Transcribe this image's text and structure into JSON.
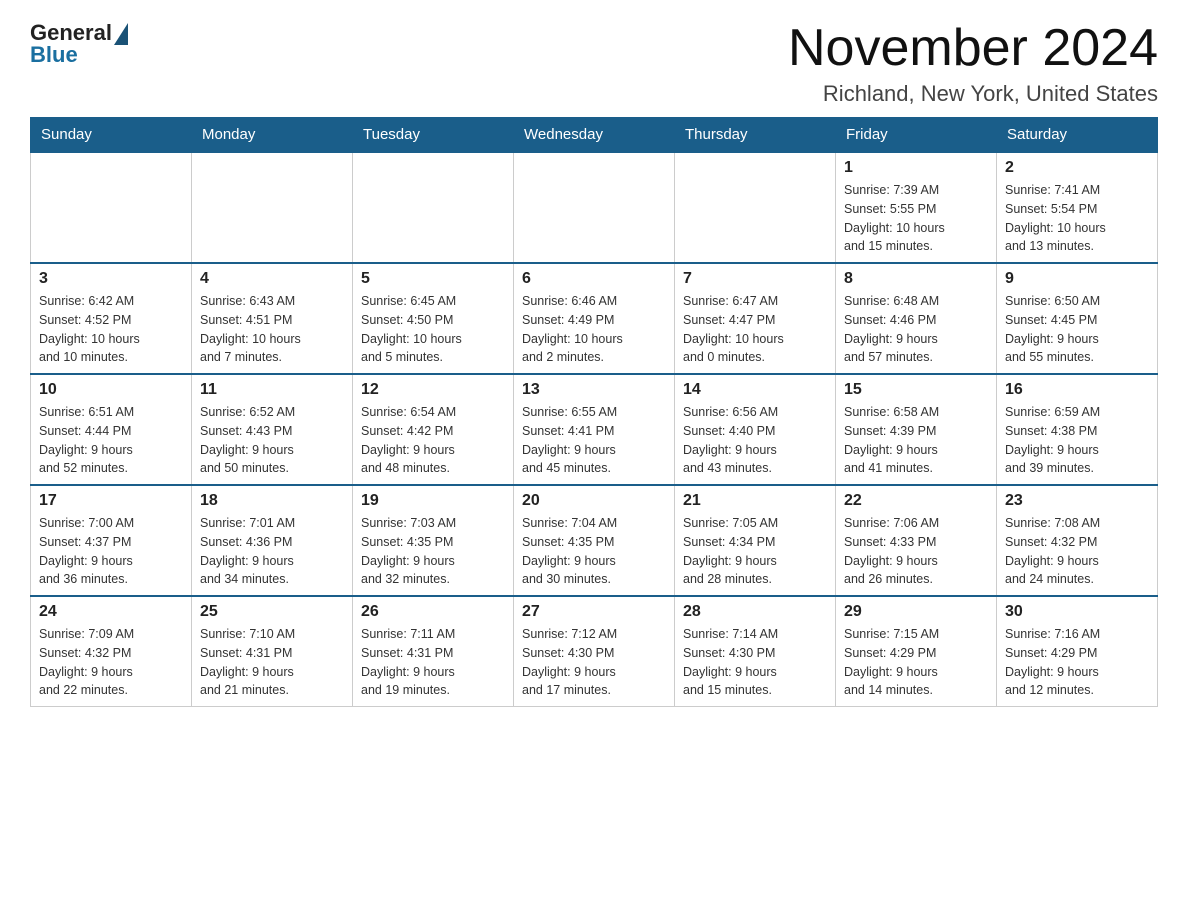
{
  "header": {
    "logo_general": "General",
    "logo_blue": "Blue",
    "title": "November 2024",
    "location": "Richland, New York, United States"
  },
  "days_of_week": [
    "Sunday",
    "Monday",
    "Tuesday",
    "Wednesday",
    "Thursday",
    "Friday",
    "Saturday"
  ],
  "weeks": [
    [
      {
        "day": "",
        "info": ""
      },
      {
        "day": "",
        "info": ""
      },
      {
        "day": "",
        "info": ""
      },
      {
        "day": "",
        "info": ""
      },
      {
        "day": "",
        "info": ""
      },
      {
        "day": "1",
        "info": "Sunrise: 7:39 AM\nSunset: 5:55 PM\nDaylight: 10 hours\nand 15 minutes."
      },
      {
        "day": "2",
        "info": "Sunrise: 7:41 AM\nSunset: 5:54 PM\nDaylight: 10 hours\nand 13 minutes."
      }
    ],
    [
      {
        "day": "3",
        "info": "Sunrise: 6:42 AM\nSunset: 4:52 PM\nDaylight: 10 hours\nand 10 minutes."
      },
      {
        "day": "4",
        "info": "Sunrise: 6:43 AM\nSunset: 4:51 PM\nDaylight: 10 hours\nand 7 minutes."
      },
      {
        "day": "5",
        "info": "Sunrise: 6:45 AM\nSunset: 4:50 PM\nDaylight: 10 hours\nand 5 minutes."
      },
      {
        "day": "6",
        "info": "Sunrise: 6:46 AM\nSunset: 4:49 PM\nDaylight: 10 hours\nand 2 minutes."
      },
      {
        "day": "7",
        "info": "Sunrise: 6:47 AM\nSunset: 4:47 PM\nDaylight: 10 hours\nand 0 minutes."
      },
      {
        "day": "8",
        "info": "Sunrise: 6:48 AM\nSunset: 4:46 PM\nDaylight: 9 hours\nand 57 minutes."
      },
      {
        "day": "9",
        "info": "Sunrise: 6:50 AM\nSunset: 4:45 PM\nDaylight: 9 hours\nand 55 minutes."
      }
    ],
    [
      {
        "day": "10",
        "info": "Sunrise: 6:51 AM\nSunset: 4:44 PM\nDaylight: 9 hours\nand 52 minutes."
      },
      {
        "day": "11",
        "info": "Sunrise: 6:52 AM\nSunset: 4:43 PM\nDaylight: 9 hours\nand 50 minutes."
      },
      {
        "day": "12",
        "info": "Sunrise: 6:54 AM\nSunset: 4:42 PM\nDaylight: 9 hours\nand 48 minutes."
      },
      {
        "day": "13",
        "info": "Sunrise: 6:55 AM\nSunset: 4:41 PM\nDaylight: 9 hours\nand 45 minutes."
      },
      {
        "day": "14",
        "info": "Sunrise: 6:56 AM\nSunset: 4:40 PM\nDaylight: 9 hours\nand 43 minutes."
      },
      {
        "day": "15",
        "info": "Sunrise: 6:58 AM\nSunset: 4:39 PM\nDaylight: 9 hours\nand 41 minutes."
      },
      {
        "day": "16",
        "info": "Sunrise: 6:59 AM\nSunset: 4:38 PM\nDaylight: 9 hours\nand 39 minutes."
      }
    ],
    [
      {
        "day": "17",
        "info": "Sunrise: 7:00 AM\nSunset: 4:37 PM\nDaylight: 9 hours\nand 36 minutes."
      },
      {
        "day": "18",
        "info": "Sunrise: 7:01 AM\nSunset: 4:36 PM\nDaylight: 9 hours\nand 34 minutes."
      },
      {
        "day": "19",
        "info": "Sunrise: 7:03 AM\nSunset: 4:35 PM\nDaylight: 9 hours\nand 32 minutes."
      },
      {
        "day": "20",
        "info": "Sunrise: 7:04 AM\nSunset: 4:35 PM\nDaylight: 9 hours\nand 30 minutes."
      },
      {
        "day": "21",
        "info": "Sunrise: 7:05 AM\nSunset: 4:34 PM\nDaylight: 9 hours\nand 28 minutes."
      },
      {
        "day": "22",
        "info": "Sunrise: 7:06 AM\nSunset: 4:33 PM\nDaylight: 9 hours\nand 26 minutes."
      },
      {
        "day": "23",
        "info": "Sunrise: 7:08 AM\nSunset: 4:32 PM\nDaylight: 9 hours\nand 24 minutes."
      }
    ],
    [
      {
        "day": "24",
        "info": "Sunrise: 7:09 AM\nSunset: 4:32 PM\nDaylight: 9 hours\nand 22 minutes."
      },
      {
        "day": "25",
        "info": "Sunrise: 7:10 AM\nSunset: 4:31 PM\nDaylight: 9 hours\nand 21 minutes."
      },
      {
        "day": "26",
        "info": "Sunrise: 7:11 AM\nSunset: 4:31 PM\nDaylight: 9 hours\nand 19 minutes."
      },
      {
        "day": "27",
        "info": "Sunrise: 7:12 AM\nSunset: 4:30 PM\nDaylight: 9 hours\nand 17 minutes."
      },
      {
        "day": "28",
        "info": "Sunrise: 7:14 AM\nSunset: 4:30 PM\nDaylight: 9 hours\nand 15 minutes."
      },
      {
        "day": "29",
        "info": "Sunrise: 7:15 AM\nSunset: 4:29 PM\nDaylight: 9 hours\nand 14 minutes."
      },
      {
        "day": "30",
        "info": "Sunrise: 7:16 AM\nSunset: 4:29 PM\nDaylight: 9 hours\nand 12 minutes."
      }
    ]
  ]
}
